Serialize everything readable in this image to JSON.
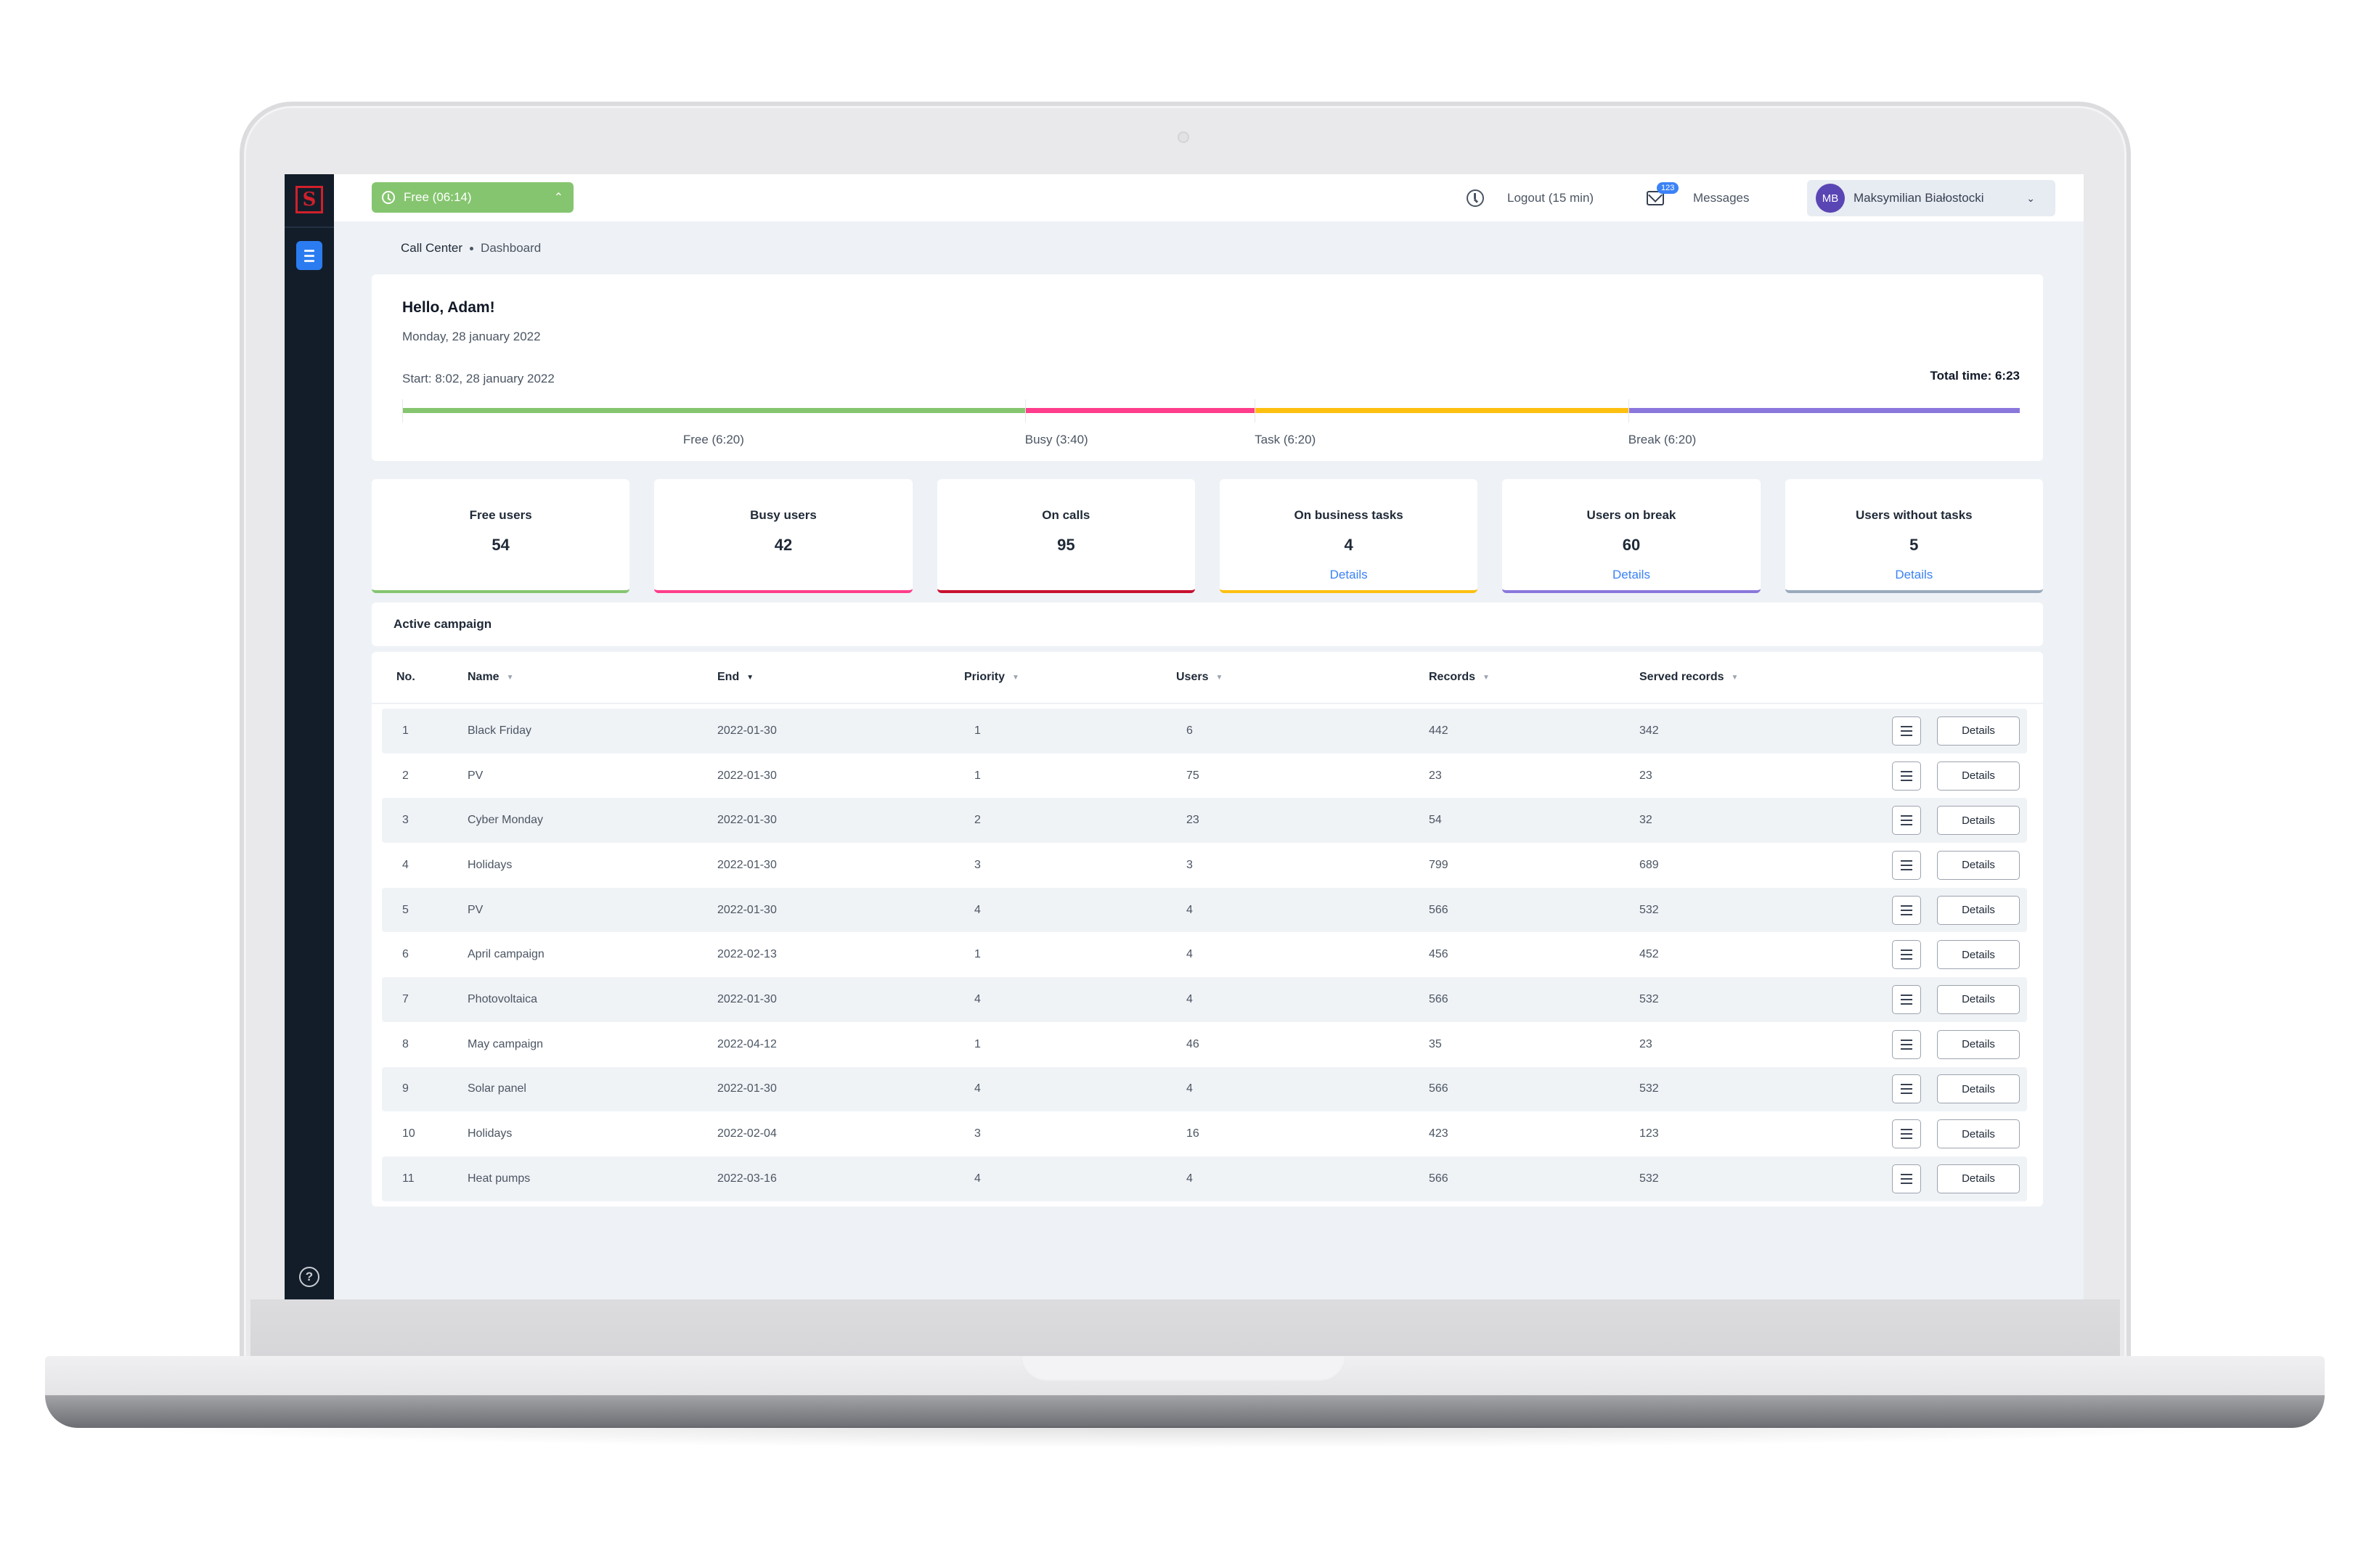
{
  "app": {
    "logo_letter": "S",
    "status_button": {
      "label": "Free (06:14)",
      "state": "free",
      "color": "#85c56f"
    },
    "logout": {
      "label": "Logout (15 min)"
    },
    "messages": {
      "label": "Messages",
      "badge_count": "123"
    },
    "user": {
      "initials": "MB",
      "name": "Maksymilian Białostocki"
    }
  },
  "breadcrumb": [
    "Call Center",
    "Dashboard"
  ],
  "greeting": {
    "title": "Hello, Adam!",
    "date": "Monday, 28 january 2022",
    "start": "Start: 8:02, 28 january 2022",
    "total_label": "Total time:",
    "total_value": "6:23",
    "timeline": [
      {
        "label": "Free (6:20)",
        "color": "#85c56f",
        "share": 0.385
      },
      {
        "label": "Busy (3:40)",
        "color": "#ff3d8b",
        "share": 0.142
      },
      {
        "label": "Task  (6:20)",
        "color": "#fdbf10",
        "share": 0.231
      },
      {
        "label": "Break (6:20)",
        "color": "#8a77dc",
        "share": 0.242
      }
    ]
  },
  "stats": [
    {
      "label": "Free users",
      "value": "54",
      "color": "#85c56f",
      "link": ""
    },
    {
      "label": "Busy users",
      "value": "42",
      "color": "#ff3d8b",
      "link": ""
    },
    {
      "label": "On calls",
      "value": "95",
      "color": "#c8102e",
      "link": ""
    },
    {
      "label": "On business tasks",
      "value": "4",
      "color": "#fdbf10",
      "link": "Details"
    },
    {
      "label": "Users on break",
      "value": "60",
      "color": "#8a77dc",
      "link": "Details"
    },
    {
      "label": "Users without tasks",
      "value": "5",
      "color": "#9aaabc",
      "link": "Details"
    }
  ],
  "campaign": {
    "title": "Active campaign",
    "columns": [
      {
        "label": "No.",
        "sortable": false
      },
      {
        "label": "Name",
        "sortable": true,
        "active": false
      },
      {
        "label": "End",
        "sortable": true,
        "active": true
      },
      {
        "label": "Priority",
        "sortable": true,
        "active": false
      },
      {
        "label": "Users",
        "sortable": true,
        "active": false
      },
      {
        "label": "Records",
        "sortable": true,
        "active": false
      },
      {
        "label": "Served records",
        "sortable": true,
        "active": false
      }
    ],
    "details_label": "Details",
    "rows": [
      {
        "no": "1",
        "name": "Black Friday",
        "end": "2022-01-30",
        "priority": "1",
        "users": "6",
        "records": "442",
        "served": "342"
      },
      {
        "no": "2",
        "name": "PV",
        "end": "2022-01-30",
        "priority": "1",
        "users": "75",
        "records": "23",
        "served": "23"
      },
      {
        "no": "3",
        "name": "Cyber Monday",
        "end": "2022-01-30",
        "priority": "2",
        "users": "23",
        "records": "54",
        "served": "32"
      },
      {
        "no": "4",
        "name": "Holidays",
        "end": "2022-01-30",
        "priority": "3",
        "users": "3",
        "records": "799",
        "served": "689"
      },
      {
        "no": "5",
        "name": "PV",
        "end": "2022-01-30",
        "priority": "4",
        "users": "4",
        "records": "566",
        "served": "532"
      },
      {
        "no": "6",
        "name": "April campaign",
        "end": "2022-02-13",
        "priority": "1",
        "users": "4",
        "records": "456",
        "served": "452"
      },
      {
        "no": "7",
        "name": "Photovoltaica",
        "end": "2022-01-30",
        "priority": "4",
        "users": "4",
        "records": "566",
        "served": "532"
      },
      {
        "no": "8",
        "name": "May campaign",
        "end": "2022-04-12",
        "priority": "1",
        "users": "46",
        "records": "35",
        "served": "23"
      },
      {
        "no": "9",
        "name": "Solar panel",
        "end": "2022-01-30",
        "priority": "4",
        "users": "4",
        "records": "566",
        "served": "532"
      },
      {
        "no": "10",
        "name": "Holidays",
        "end": "2022-02-04",
        "priority": "3",
        "users": "16",
        "records": "423",
        "served": "123"
      },
      {
        "no": "11",
        "name": "Heat pumps",
        "end": "2022-03-16",
        "priority": "4",
        "users": "4",
        "records": "566",
        "served": "532"
      }
    ]
  }
}
